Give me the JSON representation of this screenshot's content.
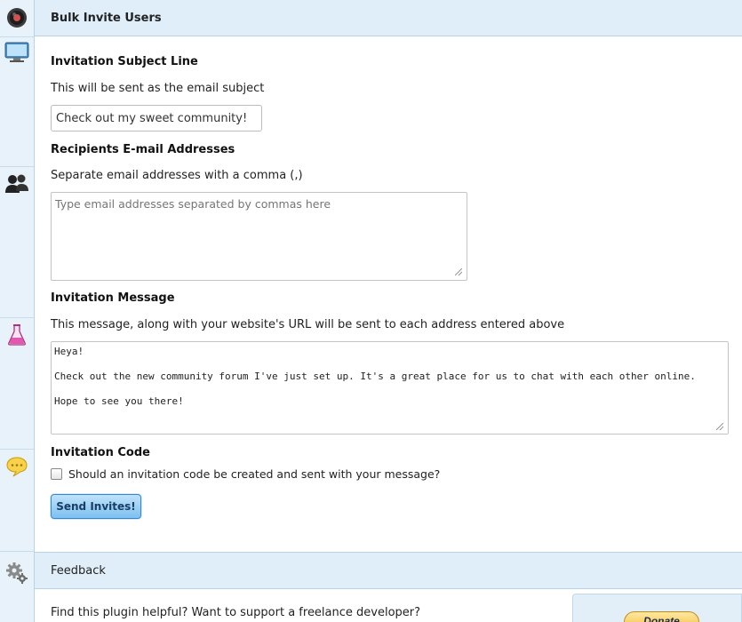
{
  "bulk_invite": {
    "title": "Bulk Invite Users",
    "subject": {
      "label": "Invitation Subject Line",
      "description": "This will be sent as the email subject",
      "value": "Check out my sweet community!"
    },
    "recipients": {
      "label": "Recipients E-mail Addresses",
      "description": "Separate email addresses with a comma (,)",
      "placeholder": "Type email addresses separated by commas here"
    },
    "message": {
      "label": "Invitation Message",
      "description": "This message, along with your website's URL will be sent to each address entered above",
      "value": "Heya!\n\nCheck out the new community forum I've just set up. It's a great place for us to chat with each other online.\n\nHope to see you there!"
    },
    "invitation_code": {
      "label": "Invitation Code",
      "checkbox_label": "Should an invitation code be created and sent with your message?",
      "checked": false
    },
    "send_button": "Send Invites!"
  },
  "feedback": {
    "title": "Feedback",
    "text": "Find this plugin helpful? Want to support a freelance developer?",
    "donate_button": "Donate"
  },
  "sidebar_icons": [
    "record-icon",
    "monitor-icon",
    "users-icon",
    "flask-icon",
    "chat-bubble-icon",
    "gears-icon"
  ]
}
